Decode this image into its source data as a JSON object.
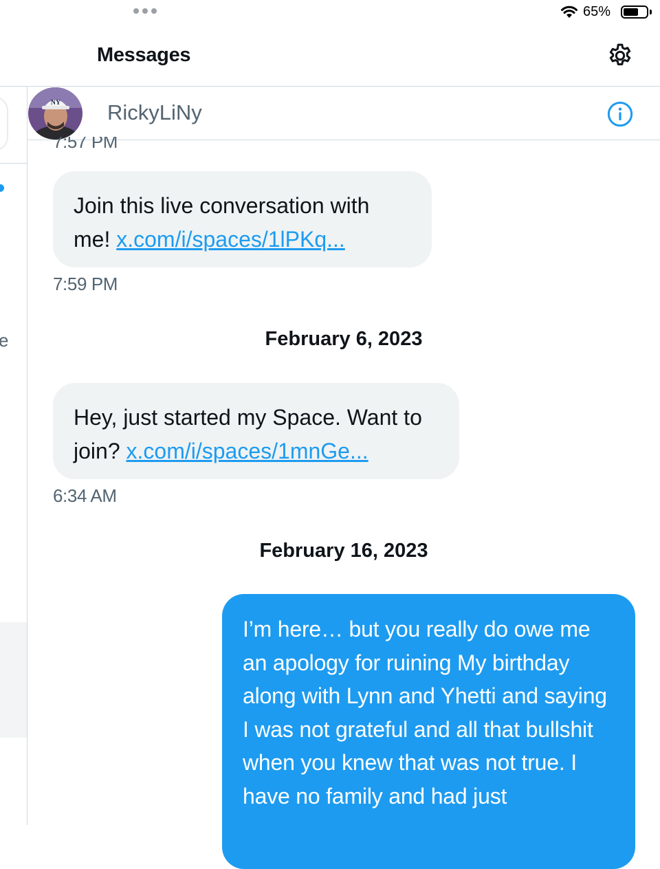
{
  "status_bar": {
    "battery_percent": "65%",
    "battery_level": 0.65
  },
  "header": {
    "title": "Messages"
  },
  "conversation": {
    "contact_name": "RickyLiNy",
    "avatar_cap_text": "NY",
    "previous_time": "7:57 PM",
    "messages": [
      {
        "text": "Join this live conversation with me! ",
        "link": "x.com/i/spaces/1lPKq...",
        "time": "7:59 PM"
      },
      {
        "date": "February 6, 2023"
      },
      {
        "text": "Hey, just started my Space. Want to join? ",
        "link": "x.com/i/spaces/1mnGe...",
        "time": "6:34 AM"
      },
      {
        "date": "February 16, 2023"
      },
      {
        "text": "I’m here… but you really do owe me an apology for ruining My birthday along with Lynn and Yhetti and saying I was not grateful and all that bullshit when you knew that was not true.  I have no family and had just"
      }
    ]
  },
  "list_pane": {
    "visible_char": "e"
  },
  "colors": {
    "accent": "#1d9bf0",
    "bubble_in": "#eff3f4",
    "secondary_text": "#536471"
  }
}
